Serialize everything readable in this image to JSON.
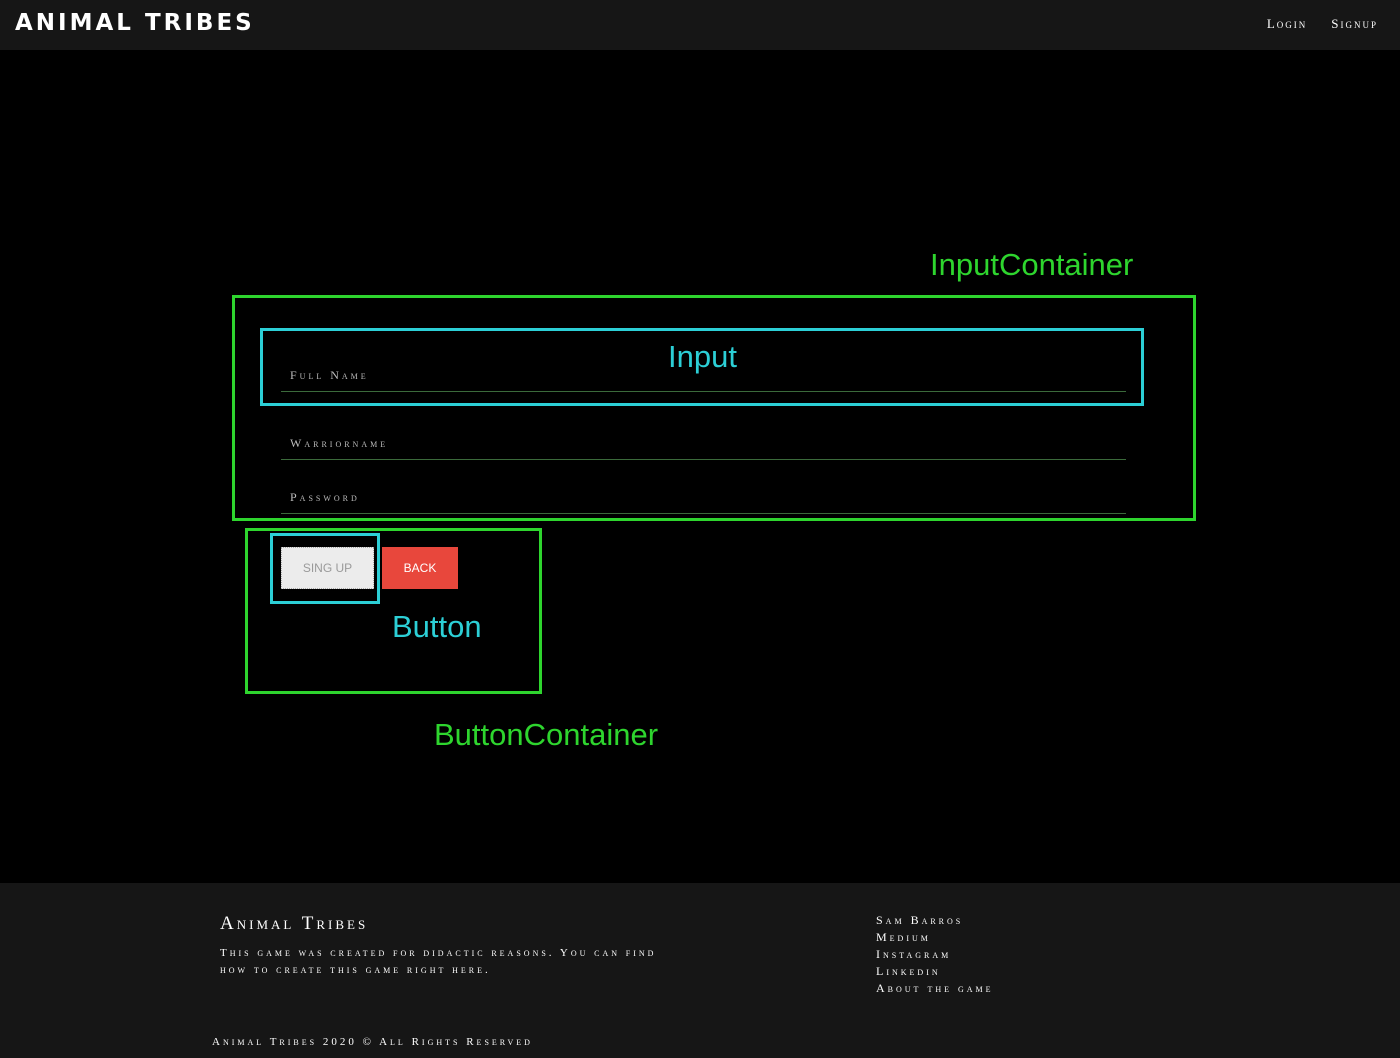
{
  "header": {
    "logo": "ANIMAL TRIBES",
    "nav": [
      {
        "label": "Login"
      },
      {
        "label": "Signup"
      }
    ]
  },
  "annotations": {
    "input_container": "InputContainer",
    "input": "Input",
    "button": "Button",
    "button_container": "ButtonContainer",
    "colors": {
      "container": "#2ed52e",
      "element": "#2ccfd6"
    }
  },
  "form": {
    "fields": [
      {
        "placeholder": "Full Name",
        "value": ""
      },
      {
        "placeholder": "Warriorname",
        "value": ""
      },
      {
        "placeholder": "Password",
        "value": ""
      }
    ],
    "signup_label": "SING UP",
    "back_label": "BACK",
    "back_color": "#e8473c"
  },
  "footer": {
    "title": "Animal Tribes",
    "description": "This game was created for didactic reasons. You can find how to create this game right here.",
    "links": [
      {
        "label": "Sam Barros"
      },
      {
        "label": "Medium"
      },
      {
        "label": "Instagram"
      },
      {
        "label": "Linkedin"
      },
      {
        "label": "About the game"
      }
    ],
    "copyright": "Animal Tribes 2020 © All Rights Reserved"
  }
}
